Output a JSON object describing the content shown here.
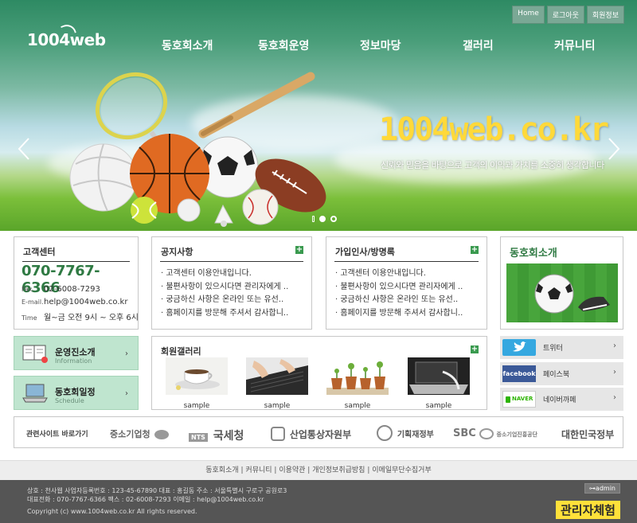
{
  "top_links": [
    "Home",
    "로그아웃",
    "회원정보"
  ],
  "logo": "1004web",
  "nav": [
    "동호회소개",
    "동호회운영",
    "정보마당",
    "갤러리",
    "커뮤니티"
  ],
  "hero": {
    "domain": "1004web.co.kr",
    "sub": "신뢰와 믿음을 바탕으로 고객의 이익과 가치를 소중히 생각합니다"
  },
  "cs": {
    "title": "고객센터",
    "phone": "070-7767-6366",
    "fax_label": "Fax.",
    "fax": "02-6008-7293",
    "email_label": "E-mail.",
    "email": "help@1004web.co.kr",
    "time_label": "Time",
    "time": "월~금 오전 9시 ~ 오후 6시"
  },
  "notice": {
    "title": "공지사항",
    "items": [
      "· 고객센터 이용안내입니다.",
      "· 불편사항이 있으시다면 관리자에게 ..",
      "· 궁금하신 사항은 온라인 또는 유선..",
      "· 홈페이지를 방문해 주셔서 감사합니.."
    ]
  },
  "guestbook": {
    "title": "가입인사/방명록",
    "items": [
      "· 고객센터 이용안내입니다.",
      "· 불편사항이 있으시다면 관리자에게 ..",
      "· 궁금하신 사항은 온라인 또는 유선..",
      "· 홈페이지를 방문해 주셔서 감사합니.."
    ]
  },
  "intro": {
    "title": "동호회소개"
  },
  "guide": {
    "title": "운영진소개",
    "sub": "Information"
  },
  "schedule": {
    "title": "동호회일정",
    "sub": "Schedule"
  },
  "gallery": {
    "title": "회원갤러리",
    "items": [
      "sample",
      "sample",
      "sample",
      "sample"
    ]
  },
  "sns": {
    "twitter": "트위터",
    "facebook": "페이스북",
    "naver": "네이버까페",
    "facebook_badge": "facebook",
    "naver_badge": "NAVER"
  },
  "partners": {
    "label": "관련사이트 바로가기",
    "items": [
      "중소기업청",
      "국세청",
      "산업통상자원부",
      "기획재정부",
      "SBC",
      "대한민국정부"
    ],
    "nts_badge": "NTS",
    "sbc_sub": "중소기업진흥공단"
  },
  "footer_links": [
    "동호회소개",
    "커뮤니티",
    "이용약관",
    "개인정보취급방침",
    "이메일무단수집거부"
  ],
  "footer": {
    "line1": "상호 : 천사웹  사업자등록번호 : 123-45-67890  대표 : 홍길동  주소 : 서울특별시 구로구 공원로3",
    "line2": "대표전화 : 070-7767-6366  팩스 : 02-6008-7293  이메일 : help@1004web.co.kr",
    "line3": "Copyright (c) www.1004web.co.kr All rights reserved.",
    "admin": "⊶admin",
    "admin_exp": "관리자체험"
  },
  "colors": {
    "green": "#3a9a4f",
    "phone": "#2f7a43",
    "hero_yellow": "#ffd93a"
  }
}
